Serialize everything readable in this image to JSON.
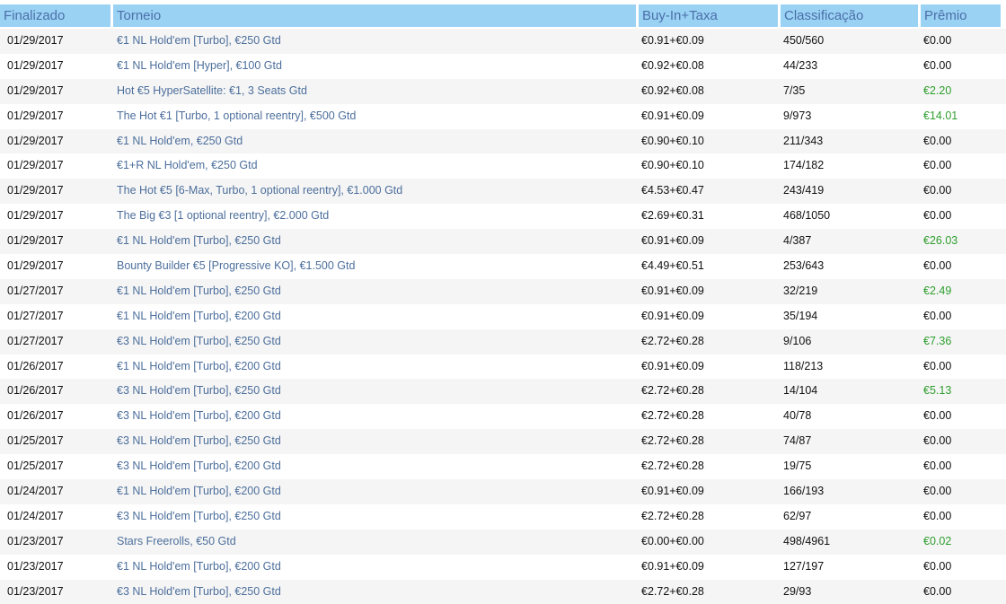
{
  "colors": {
    "header_bg": "#9ad2f4",
    "header_text": "#4b6fa9",
    "link": "#4d6f9c",
    "won": "#2e9e2e"
  },
  "columns": {
    "finalizado": "Finalizado",
    "torneio": "Torneio",
    "buyin": "Buy-In+Taxa",
    "classificacao": "Classificação",
    "premio": "Prêmio"
  },
  "rows": [
    {
      "date": "01/29/2017",
      "tournament": "€1 NL Hold'em [Turbo], €250 Gtd",
      "buyin": "€0.91+€0.09",
      "rank": "450/560",
      "prize": "€0.00",
      "won": false
    },
    {
      "date": "01/29/2017",
      "tournament": "€1 NL Hold'em [Hyper], €100 Gtd",
      "buyin": "€0.92+€0.08",
      "rank": "44/233",
      "prize": "€0.00",
      "won": false
    },
    {
      "date": "01/29/2017",
      "tournament": "Hot €5 HyperSatellite: €1, 3 Seats Gtd",
      "buyin": "€0.92+€0.08",
      "rank": "7/35",
      "prize": "€2.20",
      "won": true
    },
    {
      "date": "01/29/2017",
      "tournament": "The Hot €1 [Turbo, 1 optional reentry], €500 Gtd",
      "buyin": "€0.91+€0.09",
      "rank": "9/973",
      "prize": "€14.01",
      "won": true
    },
    {
      "date": "01/29/2017",
      "tournament": "€1 NL Hold'em, €250 Gtd",
      "buyin": "€0.90+€0.10",
      "rank": "211/343",
      "prize": "€0.00",
      "won": false
    },
    {
      "date": "01/29/2017",
      "tournament": "€1+R NL Hold'em, €250 Gtd",
      "buyin": "€0.90+€0.10",
      "rank": "174/182",
      "prize": "€0.00",
      "won": false
    },
    {
      "date": "01/29/2017",
      "tournament": "The Hot €5 [6-Max, Turbo, 1 optional reentry], €1.000 Gtd",
      "buyin": "€4.53+€0.47",
      "rank": "243/419",
      "prize": "€0.00",
      "won": false
    },
    {
      "date": "01/29/2017",
      "tournament": "The Big €3 [1 optional reentry], €2.000 Gtd",
      "buyin": "€2.69+€0.31",
      "rank": "468/1050",
      "prize": "€0.00",
      "won": false
    },
    {
      "date": "01/29/2017",
      "tournament": "€1 NL Hold'em [Turbo], €250 Gtd",
      "buyin": "€0.91+€0.09",
      "rank": "4/387",
      "prize": "€26.03",
      "won": true
    },
    {
      "date": "01/29/2017",
      "tournament": "Bounty Builder €5 [Progressive KO], €1.500 Gtd",
      "buyin": "€4.49+€0.51",
      "rank": "253/643",
      "prize": "€0.00",
      "won": false
    },
    {
      "date": "01/27/2017",
      "tournament": "€1 NL Hold'em [Turbo], €250 Gtd",
      "buyin": "€0.91+€0.09",
      "rank": "32/219",
      "prize": "€2.49",
      "won": true
    },
    {
      "date": "01/27/2017",
      "tournament": "€1 NL Hold'em [Turbo], €200 Gtd",
      "buyin": "€0.91+€0.09",
      "rank": "35/194",
      "prize": "€0.00",
      "won": false
    },
    {
      "date": "01/27/2017",
      "tournament": "€3 NL Hold'em [Turbo], €250 Gtd",
      "buyin": "€2.72+€0.28",
      "rank": "9/106",
      "prize": "€7.36",
      "won": true
    },
    {
      "date": "01/26/2017",
      "tournament": "€1 NL Hold'em [Turbo], €200 Gtd",
      "buyin": "€0.91+€0.09",
      "rank": "118/213",
      "prize": "€0.00",
      "won": false
    },
    {
      "date": "01/26/2017",
      "tournament": "€3 NL Hold'em [Turbo], €250 Gtd",
      "buyin": "€2.72+€0.28",
      "rank": "14/104",
      "prize": "€5.13",
      "won": true
    },
    {
      "date": "01/26/2017",
      "tournament": "€3 NL Hold'em [Turbo], €200 Gtd",
      "buyin": "€2.72+€0.28",
      "rank": "40/78",
      "prize": "€0.00",
      "won": false
    },
    {
      "date": "01/25/2017",
      "tournament": "€3 NL Hold'em [Turbo], €250 Gtd",
      "buyin": "€2.72+€0.28",
      "rank": "74/87",
      "prize": "€0.00",
      "won": false
    },
    {
      "date": "01/25/2017",
      "tournament": "€3 NL Hold'em [Turbo], €200 Gtd",
      "buyin": "€2.72+€0.28",
      "rank": "19/75",
      "prize": "€0.00",
      "won": false
    },
    {
      "date": "01/24/2017",
      "tournament": "€1 NL Hold'em [Turbo], €200 Gtd",
      "buyin": "€0.91+€0.09",
      "rank": "166/193",
      "prize": "€0.00",
      "won": false
    },
    {
      "date": "01/24/2017",
      "tournament": "€3 NL Hold'em [Turbo], €250 Gtd",
      "buyin": "€2.72+€0.28",
      "rank": "62/97",
      "prize": "€0.00",
      "won": false
    },
    {
      "date": "01/23/2017",
      "tournament": "Stars Freerolls, €50 Gtd",
      "buyin": "€0.00+€0.00",
      "rank": "498/4961",
      "prize": "€0.02",
      "won": true
    },
    {
      "date": "01/23/2017",
      "tournament": "€1 NL Hold'em [Turbo], €200 Gtd",
      "buyin": "€0.91+€0.09",
      "rank": "127/197",
      "prize": "€0.00",
      "won": false
    },
    {
      "date": "01/23/2017",
      "tournament": "€3 NL Hold'em [Turbo], €250 Gtd",
      "buyin": "€2.72+€0.28",
      "rank": "29/93",
      "prize": "€0.00",
      "won": false
    }
  ]
}
